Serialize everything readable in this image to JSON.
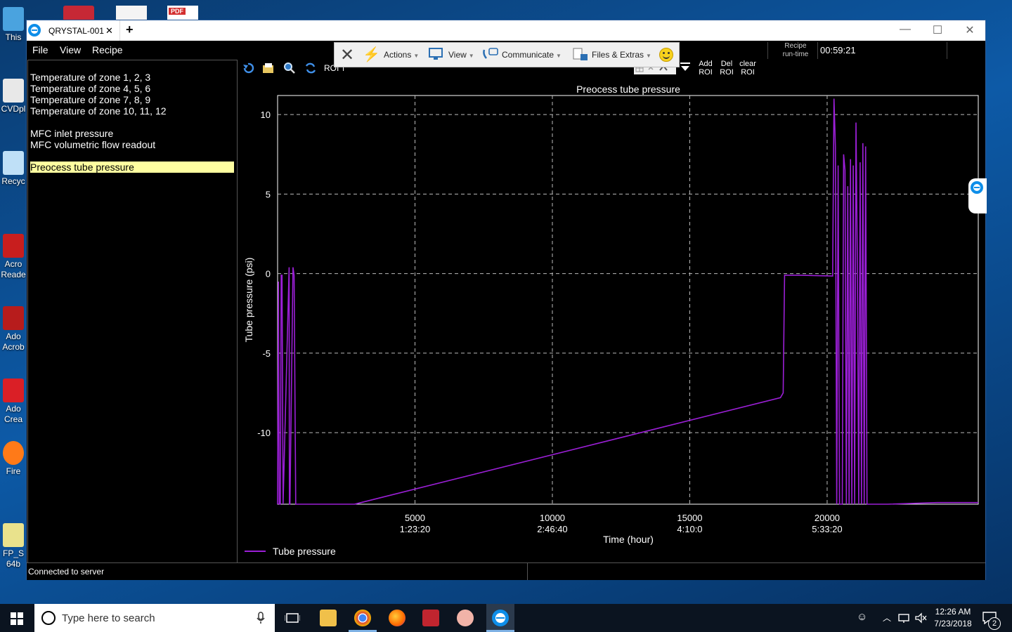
{
  "desktop": {
    "icons": [
      {
        "label": "This",
        "color": "#4aa3df"
      },
      {
        "label": "CVDpl",
        "color": "#e8e8e8"
      },
      {
        "label": "Recyc",
        "color": "#bfe0f7"
      },
      {
        "label": "Acro\nReade",
        "color": "#c81e1e"
      },
      {
        "label": "Ado\nAcrob",
        "color": "#b71c1c"
      },
      {
        "label": "Ado\nCrea",
        "color": "#da1f26"
      },
      {
        "label": "Fire",
        "color": "#ff7a18"
      },
      {
        "label": "FP_S\n64b",
        "color": "#e9e28c"
      }
    ],
    "top_icons": [
      "red-app",
      "chart-app",
      "PDF"
    ]
  },
  "window": {
    "tab_title": "QRYSTAL-001",
    "tab_close": "✕",
    "new_tab": "+",
    "minimize": "—",
    "maximize": "☐",
    "close": "✕"
  },
  "menu": {
    "file": "File",
    "view": "View",
    "recipe": "Recipe"
  },
  "teamviewer": {
    "close": "✕",
    "actions": "Actions",
    "view": "View",
    "communicate": "Communicate",
    "files": "Files & Extras"
  },
  "recipe": {
    "label_line1": "Recipe",
    "label_line2": "run-time",
    "value": "00:59:21"
  },
  "left_panel": {
    "items": [
      "Temperature of zone 1, 2, 3",
      "Temperature of zone 4, 5, 6",
      "Temperature of zone 7, 8, 9",
      "Temperature of zone 10, 11, 12",
      "MFC inlet pressure",
      "MFC volumetric flow readout",
      "Preocess tube pressure"
    ],
    "selected_index": 6
  },
  "plot_toolbar": {
    "roi_label": "ROI",
    "add_roi": [
      "Add",
      "ROI"
    ],
    "del_roi": [
      "Del",
      "ROI"
    ],
    "clear_roi": [
      "clear",
      "ROI"
    ]
  },
  "status": {
    "text": "Connected to server"
  },
  "taskbar": {
    "search_placeholder": "Type here to search",
    "time": "12:26 AM",
    "date": "7/23/2018",
    "notification_count": "2"
  },
  "chart_data": {
    "type": "line",
    "title": "Preocess tube pressure",
    "xlabel": "Time (hour)",
    "ylabel": "Tube pressure (psi)",
    "xlim": [
      0,
      25500
    ],
    "ylim": [
      -14.5,
      11.2
    ],
    "x_ticks": [
      {
        "value": 5000,
        "label1": "5000",
        "label2": "1:23:20"
      },
      {
        "value": 10000,
        "label1": "10000",
        "label2": "2:46:40"
      },
      {
        "value": 15000,
        "label1": "15000",
        "label2": "4:10:0"
      },
      {
        "value": 20000,
        "label1": "20000",
        "label2": "5:33:20"
      }
    ],
    "y_ticks": [
      10,
      5,
      0,
      -5,
      -10
    ],
    "grid": true,
    "legend_position": "bottom-left",
    "series": [
      {
        "name": "Tube pressure",
        "color": "#9b1fd6",
        "x": [
          0,
          30,
          60,
          100,
          130,
          160,
          200,
          420,
          430,
          450,
          560,
          600,
          660,
          690,
          720,
          740,
          780,
          900,
          2800,
          18300,
          18400,
          18450,
          19000,
          20200,
          20250,
          20300,
          20350,
          20400,
          20450,
          20500,
          20550,
          20600,
          20650,
          20700,
          20750,
          20800,
          20850,
          20900,
          20950,
          21000,
          21050,
          21100,
          21150,
          21200,
          21250,
          21300,
          21350,
          21400,
          21450,
          21500,
          21550,
          21600,
          21650,
          21700,
          21750,
          21800,
          21850,
          21900,
          21950,
          22000,
          22050,
          22100,
          22200,
          24000,
          25500
        ],
        "y": [
          -14.5,
          -0.5,
          -14.5,
          -14.5,
          -0.1,
          -0.1,
          -14.5,
          0.4,
          -14.5,
          -14.5,
          0.4,
          -0.1,
          -14.5,
          -14.5,
          -14.5,
          -14.5,
          -14.5,
          -14.5,
          -14.5,
          -7.8,
          -7.5,
          -0.1,
          -0.1,
          -0.15,
          11,
          8,
          -14.5,
          6.8,
          -14.5,
          -14.5,
          -14.5,
          7.5,
          6.5,
          -14.5,
          5.5,
          -14.5,
          7.2,
          -14.5,
          6.8,
          -14.5,
          9.5,
          0.5,
          -14.5,
          7,
          -14.5,
          8.2,
          -14.5,
          8,
          -14.5,
          -14.5,
          -14.5,
          -14.5,
          -14.5,
          -14.5,
          -14.5,
          -14.5,
          -14.5,
          -14.5,
          -14.5,
          -14.5,
          -14.5,
          -14.5,
          -14.5,
          -14.4,
          -14.4
        ]
      }
    ]
  }
}
